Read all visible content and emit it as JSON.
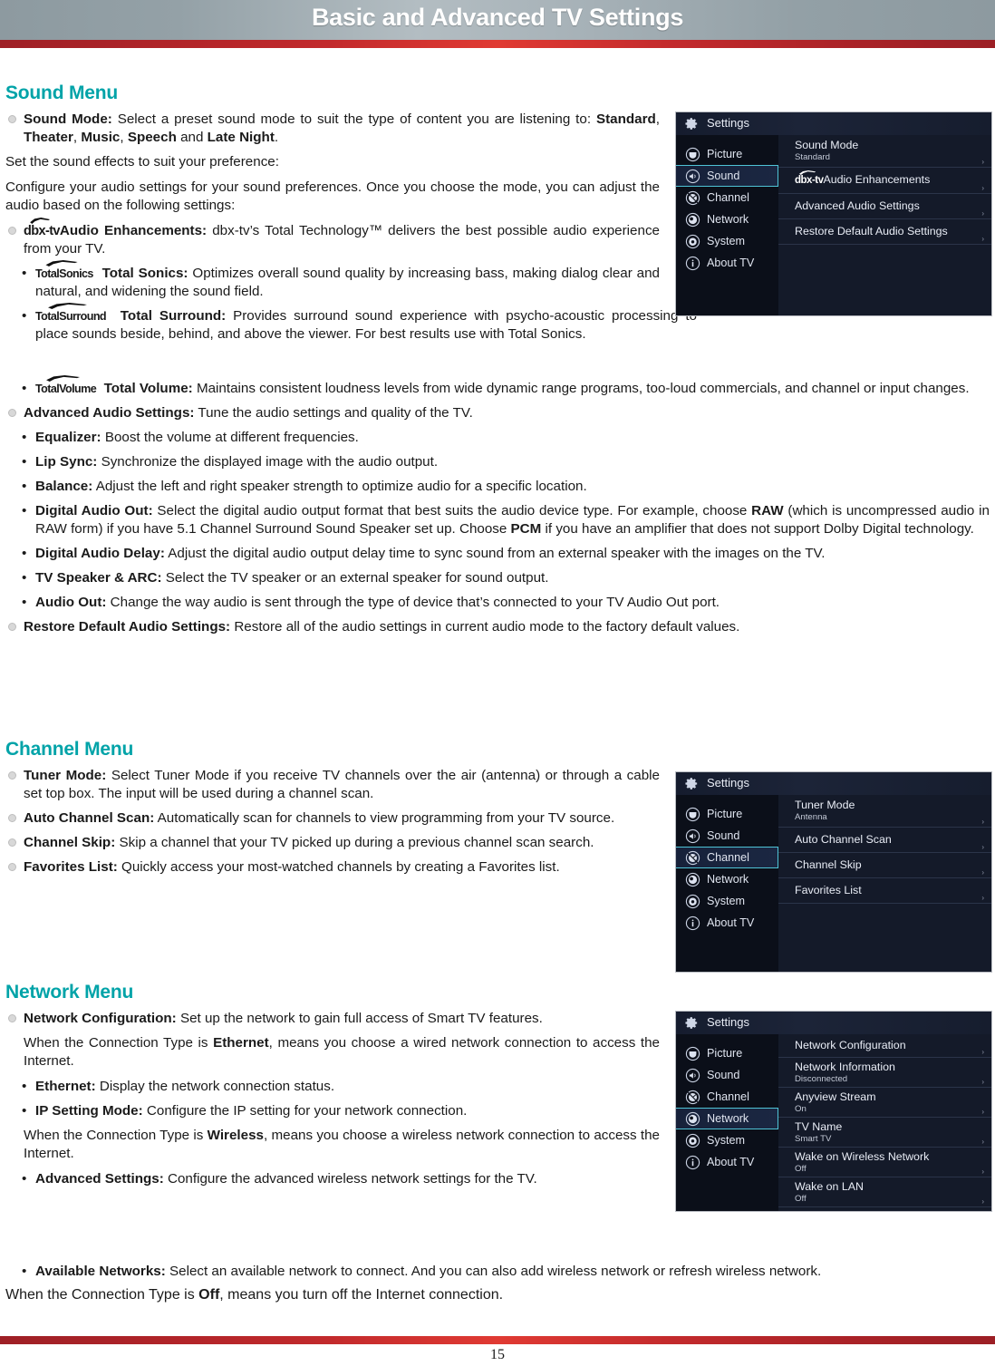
{
  "header": {
    "title": "Basic and Advanced TV Settings"
  },
  "footer": {
    "page_number": "15"
  },
  "sound_section": {
    "heading": "Sound Menu",
    "sound_mode": {
      "term": "Sound Mode:",
      "text_1": " Select a preset sound mode to suit the type of content you are listening to: ",
      "opt1": "Standard",
      "sep1": ", ",
      "opt2": "Theater",
      "sep2": ", ",
      "opt3": "Music",
      "sep3": ", ",
      "opt4": "Speech",
      "sep4": " and ",
      "opt5": "Late Night",
      "end": "."
    },
    "para_effects": "Set the sound effects to suit your preference:",
    "para_configure": "Configure your audio settings for your sound preferences. Once you choose the mode, you can adjust the audio based on the following settings:",
    "audio_enhancements": {
      "logo": "dbx-tv",
      "term": "Audio Enhancements:",
      "text": " dbx-tv’s Total Technology™ delivers the best possible audio experience from your TV."
    },
    "total_sonics": {
      "logo": "TotalSonics",
      "term": "Total Sonics:",
      "text": " Optimizes overall sound quality by increasing bass, making dialog clear and natural, and widening the sound field."
    },
    "total_surround": {
      "logo": "TotalSurround",
      "term": "Total Surround:",
      "text": " Provides surround sound experience with psycho-acoustic processing to place sounds beside, behind, and above the viewer. For best results use with Total Sonics."
    },
    "total_volume": {
      "logo": "TotalVolume",
      "term": "Total Volume:",
      "text": " Maintains consistent loudness levels from wide dynamic range programs, too-loud commercials, and channel or input changes."
    },
    "advanced_audio": {
      "term": "Advanced Audio Settings:",
      "text": " Tune the audio settings and quality of the TV."
    },
    "equalizer": {
      "term": "Equalizer:",
      "text": " Boost the volume at different frequencies."
    },
    "lip_sync": {
      "term": "Lip Sync:",
      "text": " Synchronize the displayed image with the audio output."
    },
    "balance": {
      "term": "Balance:",
      "text": " Adjust the left and right speaker strength to optimize audio for a specific location."
    },
    "digital_audio_out": {
      "term": "Digital Audio Out:",
      "text_a": " Select the digital audio output format that best suits the audio device type. For example, choose ",
      "raw": "RAW",
      "text_b": " (which is uncompressed audio in RAW form) if you have 5.1 Channel Surround Sound Speaker set up. Choose ",
      "pcm": "PCM",
      "text_c": " if you have an amplifier that does not support Dolby Digital technology."
    },
    "digital_audio_delay": {
      "term": "Digital Audio Delay:",
      "text": " Adjust the digital audio output delay time to sync sound from an external speaker with the images on the TV."
    },
    "tv_speaker_arc": {
      "term": "TV Speaker & ARC:",
      "text": " Select the TV speaker or an external speaker for sound output."
    },
    "audio_out": {
      "term": "Audio Out:",
      "text": " Change the way audio is sent through the type of device that’s connected to your TV Audio Out port."
    },
    "restore_default": {
      "term": "Restore Default Audio Settings:",
      "text": " Restore all of the audio settings in current audio mode to the factory default values."
    }
  },
  "channel_section": {
    "heading": "Channel Menu",
    "tuner_mode": {
      "term": "Tuner Mode:",
      "text": " Select Tuner Mode if you receive TV channels over the air (antenna) or through a cable set top box. The input will be used during a channel scan."
    },
    "auto_scan": {
      "term": "Auto Channel Scan:",
      "text": " Automatically scan for channels to view programming from your TV source."
    },
    "channel_skip": {
      "term": "Channel Skip:",
      "text": " Skip a channel that your TV picked up during a previous channel scan search."
    },
    "favorites": {
      "term": "Favorites List:",
      "text": " Quickly access your most-watched channels by creating a Favorites list."
    }
  },
  "network_section": {
    "heading": "Network Menu",
    "network_config": {
      "term": "Network Configuration:",
      "text": " Set up the network to gain full access of Smart TV features."
    },
    "ethernet_intro": {
      "a": "When the Connection Type is ",
      "b": "Ethernet",
      "c": ", means you choose a wired network connection to access the Internet."
    },
    "ethernet": {
      "term": "Ethernet:",
      "text": " Display the network connection status."
    },
    "ip_setting": {
      "term": "IP Setting Mode:",
      "text": " Configure the IP setting for your network connection."
    },
    "wireless_intro": {
      "a": "When the Connection Type is ",
      "b": "Wireless",
      "c": ", means you choose a wireless network connection to access the Internet."
    },
    "advanced_settings": {
      "term": "Advanced Settings:",
      "text": " Configure the advanced wireless network settings for the TV."
    },
    "available_networks": {
      "term": "Available Networks:",
      "text": " Select an available network to connect. And you can also add wireless network or refresh wireless network."
    },
    "off_intro": {
      "a": "When the Connection Type is ",
      "b": "Off",
      "c": ", means you turn off the Internet connection."
    }
  },
  "tv_ui": {
    "title": "Settings",
    "nav": [
      {
        "label": "Picture",
        "icon": "picture-icon"
      },
      {
        "label": "Sound",
        "icon": "sound-icon"
      },
      {
        "label": "Channel",
        "icon": "channel-icon"
      },
      {
        "label": "Network",
        "icon": "network-icon"
      },
      {
        "label": "System",
        "icon": "system-icon"
      },
      {
        "label": "About TV",
        "icon": "info-icon"
      }
    ],
    "panel_sound": {
      "active": "Sound",
      "rows": [
        {
          "label": "Sound Mode",
          "value": "Standard"
        },
        {
          "label": "Audio Enhancements",
          "value": "",
          "logo": "dbx-tv"
        },
        {
          "label": "Advanced Audio Settings",
          "value": ""
        },
        {
          "label": "Restore Default Audio Settings",
          "value": ""
        }
      ]
    },
    "panel_channel": {
      "active": "Channel",
      "rows": [
        {
          "label": "Tuner Mode",
          "value": "Antenna"
        },
        {
          "label": "Auto Channel Scan",
          "value": ""
        },
        {
          "label": "Channel Skip",
          "value": ""
        },
        {
          "label": "Favorites List",
          "value": ""
        }
      ]
    },
    "panel_network": {
      "active": "Network",
      "rows": [
        {
          "label": "Network Configuration",
          "value": ""
        },
        {
          "label": "Network Information",
          "value": "Disconnected"
        },
        {
          "label": "Anyview Stream",
          "value": "On"
        },
        {
          "label": "TV Name",
          "value": "Smart TV"
        },
        {
          "label": "Wake on Wireless Network",
          "value": "Off"
        },
        {
          "label": "Wake on LAN",
          "value": "Off"
        }
      ]
    }
  },
  "colors": {
    "accent_teal": "#00a3a8",
    "rule_red": "#c22a2c",
    "header_gray": "#a7b2b8",
    "tv_panel_bg": "#0f1420",
    "tv_highlight": "#4fc3d6"
  }
}
